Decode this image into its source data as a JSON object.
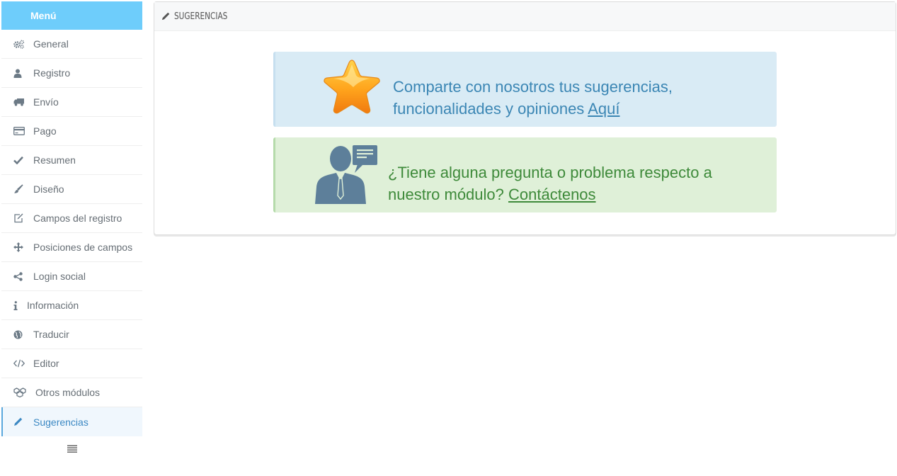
{
  "sidebar": {
    "header": "Menú",
    "items": [
      {
        "label": "General",
        "icon": "cogs-icon"
      },
      {
        "label": "Registro",
        "icon": "user-icon"
      },
      {
        "label": "Envío",
        "icon": "truck-icon"
      },
      {
        "label": "Pago",
        "icon": "credit-card-icon"
      },
      {
        "label": "Resumen",
        "icon": "check-icon"
      },
      {
        "label": "Diseño",
        "icon": "brush-icon"
      },
      {
        "label": "Campos del registro",
        "icon": "edit-icon"
      },
      {
        "label": "Posiciones de campos",
        "icon": "move-arrows-icon"
      },
      {
        "label": "Login social",
        "icon": "share-icon"
      },
      {
        "label": "Información",
        "icon": "info-icon"
      },
      {
        "label": "Traducir",
        "icon": "globe-icon"
      },
      {
        "label": "Editor",
        "icon": "code-icon"
      },
      {
        "label": "Otros módulos",
        "icon": "cubes-icon"
      },
      {
        "label": "Sugerencias",
        "icon": "pencil-icon",
        "active": true
      }
    ]
  },
  "panel": {
    "title": "SUGERENCIAS",
    "suggest": {
      "line1": "Comparte con nosotros tus sugerencias,",
      "line2": "funcionalidades y opiniones",
      "link": "Aquí"
    },
    "contact": {
      "line1": "¿Tiene alguna pregunta o problema respecto a",
      "line2": "nuestro módulo?",
      "link": "Contáctenos"
    }
  },
  "colors": {
    "menu_header": "#6ecdfb",
    "info_bg": "#d9ebf5",
    "info_text": "#3b86b4",
    "success_bg": "#dff0d8",
    "success_text": "#3e8a3a",
    "active_item": "#3b88c3"
  }
}
